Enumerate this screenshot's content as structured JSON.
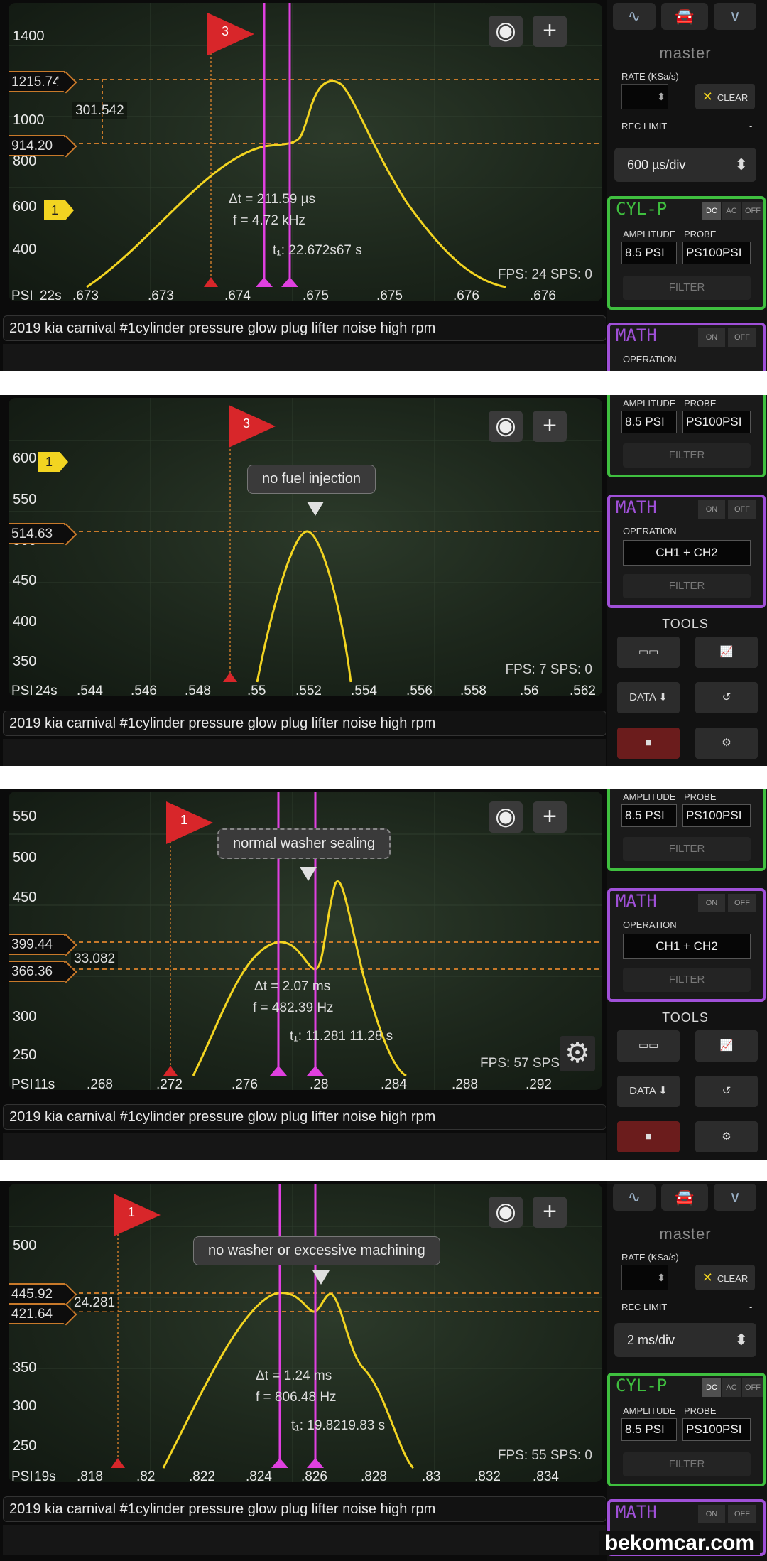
{
  "app": {
    "footer_brand": "bekomcar.com"
  },
  "icons": {
    "eye": "eye-icon",
    "plus": "plus-icon",
    "gear": "gear-icon",
    "car": "car-icon",
    "sine": "sine-wave-icon",
    "chevron": "chevron-down-icon"
  },
  "colors": {
    "trace": "#f2d421",
    "cursor": "#e040e0",
    "hcursor": "#c8792a",
    "trigger": "#d8262a",
    "cylp": "#3fbf3f",
    "math": "#a050d8"
  },
  "panels": [
    {
      "title": "2019 kia carnival #1cylinder pressure glow plug lifter noise high rpm",
      "y_ticks": [
        "1400",
        "1000",
        "800",
        "600",
        "400"
      ],
      "x_ticks": [
        "22s",
        ".673",
        ".673",
        ".674",
        ".675",
        ".675",
        ".676",
        ".676"
      ],
      "psi_label": "PSI",
      "cursor_top": "1215.74",
      "cursor_bottom": "914.20",
      "cursor_diff": "301.542",
      "delta_t": "Δt = 211.59 µs",
      "freq": "f = 4.72 kHz",
      "t1": "t₁: 22.672s67 s",
      "fps": "FPS: 24  SPS: 0",
      "trigger_label": "3",
      "channel_marker": "1",
      "annotation": ""
    },
    {
      "title": "2019 kia carnival #1cylinder pressure glow plug lifter noise high rpm",
      "y_ticks": [
        "600",
        "550",
        "500",
        "450",
        "400",
        "350"
      ],
      "x_ticks": [
        "24s",
        ".544",
        ".546",
        ".548",
        ".55",
        ".552",
        ".554",
        ".556",
        ".558",
        ".56",
        ".562"
      ],
      "psi_label": "PSI",
      "cursor_top": "514.63",
      "cursor_bottom": "",
      "cursor_diff": "",
      "delta_t": "",
      "freq": "",
      "t1": "",
      "fps": "FPS: 7  SPS: 0",
      "trigger_label": "3",
      "channel_marker": "1",
      "annotation": "no fuel injection"
    },
    {
      "title": "2019 kia carnival #1cylinder pressure glow plug lifter noise high rpm",
      "y_ticks": [
        "550",
        "500",
        "450",
        "300",
        "250"
      ],
      "x_ticks": [
        "11s",
        ".268",
        ".272",
        ".276",
        ".28",
        ".284",
        ".288",
        ".292"
      ],
      "psi_label": "PSI",
      "cursor_top": "399.44",
      "cursor_bottom": "366.36",
      "cursor_diff": "33.082",
      "delta_t": "Δt = 2.07 ms",
      "freq": "f = 482.39 Hz",
      "t1": "t₁: 11.281 11.28 s",
      "fps": "FPS: 57  SPS",
      "trigger_label": "1",
      "channel_marker": "",
      "annotation": "normal washer sealing"
    },
    {
      "title": "2019 kia carnival #1cylinder pressure glow plug lifter noise high rpm",
      "y_ticks": [
        "500",
        "350",
        "300",
        "250"
      ],
      "x_ticks": [
        "19s",
        ".818",
        ".82",
        ".822",
        ".824",
        ".826",
        ".828",
        ".83",
        ".832",
        ".834"
      ],
      "psi_label": "PSI",
      "cursor_top": "445.92",
      "cursor_bottom": "421.64",
      "cursor_diff": "24.281",
      "delta_t": "Δt = 1.24 ms",
      "freq": "f = 806.48 Hz",
      "t1": "t₁: 19.8219.83 s",
      "fps": "FPS: 55  SPS: 0",
      "trigger_label": "1",
      "channel_marker": "",
      "annotation": "no washer or excessive machining"
    }
  ],
  "sidebar": {
    "master": "master",
    "rate_label": "RATE (KSa/s)",
    "clear": "CLEAR",
    "rec_limit": "REC LIMIT",
    "rec_limit_val": "-",
    "timebase_1": "600 µs/div",
    "timebase_4": "2 ms/div",
    "cylp": "CYL-P",
    "dc": "DC",
    "ac": "AC",
    "off": "OFF",
    "on": "ON",
    "amplitude": "AMPLITUDE",
    "probe": "PROBE",
    "amp_val": "8.5 PSI",
    "probe_val": "PS100PSI",
    "filter": "FILTER",
    "math": "MATH",
    "operation": "OPERATION",
    "op_val": "CH1 + CH2",
    "tools": "TOOLS",
    "data": "DATA"
  }
}
